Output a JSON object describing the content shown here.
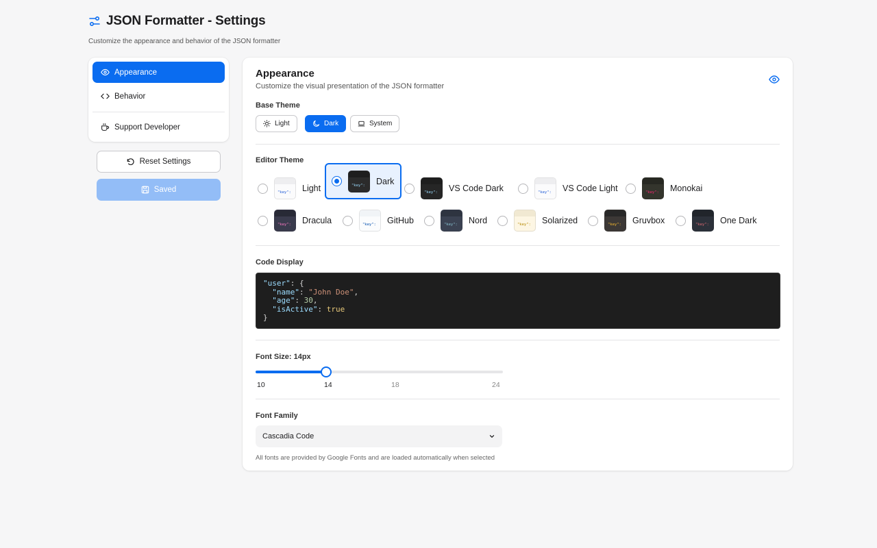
{
  "header": {
    "title": "JSON Formatter - Settings",
    "subtitle": "Customize the appearance and behavior of the JSON formatter"
  },
  "sidebar": {
    "items": [
      {
        "label": "Appearance",
        "icon": "eye-icon",
        "active": true
      },
      {
        "label": "Behavior",
        "icon": "code-icon",
        "active": false
      },
      {
        "label": "Support Developer",
        "icon": "coffee-icon",
        "active": false
      }
    ]
  },
  "actions": {
    "reset_label": "Reset Settings",
    "saved_label": "Saved"
  },
  "panel": {
    "title": "Appearance",
    "description": "Customize the visual presentation of the JSON formatter"
  },
  "base_theme": {
    "label": "Base Theme",
    "options": [
      {
        "label": "Light",
        "icon": "sun-icon",
        "active": false
      },
      {
        "label": "Dark",
        "icon": "moon-icon",
        "active": true
      },
      {
        "label": "System",
        "icon": "laptop-icon",
        "active": false
      }
    ]
  },
  "editor_theme": {
    "label": "Editor Theme",
    "swatch_key": "\"key\":",
    "options": [
      {
        "label": "Light",
        "selected": false,
        "bg": "#fbfbfc",
        "bar": "#eeeef0",
        "key": "#1f5bd6"
      },
      {
        "label": "Dark",
        "selected": true,
        "bg": "#2b2b2b",
        "bar": "#1e1e1e",
        "key": "#9cdcfe"
      },
      {
        "label": "VS Code Dark",
        "selected": false,
        "bg": "#262626",
        "bar": "#1e1e1e",
        "key": "#9cdcfe"
      },
      {
        "label": "VS Code Light",
        "selected": false,
        "bg": "#fbfbfc",
        "bar": "#eeeef0",
        "key": "#1f5bd6"
      },
      {
        "label": "Monokai",
        "selected": false,
        "bg": "#34352d",
        "bar": "#272822",
        "key": "#f92672"
      },
      {
        "label": "Dracula",
        "selected": false,
        "bg": "#3a3b4d",
        "bar": "#282a36",
        "key": "#ff79c6"
      },
      {
        "label": "GitHub",
        "selected": false,
        "bg": "#fbfcfd",
        "bar": "#f1f4f7",
        "key": "#0550ae"
      },
      {
        "label": "Nord",
        "selected": false,
        "bg": "#3b4252",
        "bar": "#2e3440",
        "key": "#88c0d0"
      },
      {
        "label": "Solarized",
        "selected": false,
        "bg": "#fdf6e3",
        "bar": "#f1e9d2",
        "key": "#b58900"
      },
      {
        "label": "Gruvbox",
        "selected": false,
        "bg": "#3c3836",
        "bar": "#282828",
        "key": "#fabd2f"
      },
      {
        "label": "One Dark",
        "selected": false,
        "bg": "#2c313a",
        "bar": "#21252b",
        "key": "#e06c75"
      }
    ]
  },
  "code_display": {
    "label": "Code Display",
    "sample": {
      "user_key": "\"user\"",
      "name_key": "\"name\"",
      "name_val": "\"John Doe\"",
      "age_key": "\"age\"",
      "age_val": "30",
      "active_key": "\"isActive\"",
      "active_val": "true"
    }
  },
  "font_size": {
    "label": "Font Size: 14px",
    "min": 10,
    "max": 24,
    "value": 14,
    "ticks": [
      "10",
      "14",
      "18",
      "24"
    ]
  },
  "font_family": {
    "label": "Font Family",
    "value": "Cascadia Code",
    "hint": "All fonts are provided by Google Fonts and are loaded automatically when selected"
  },
  "colors": {
    "accent": "#0a6cf0",
    "saved_bg": "#93bdf7"
  }
}
